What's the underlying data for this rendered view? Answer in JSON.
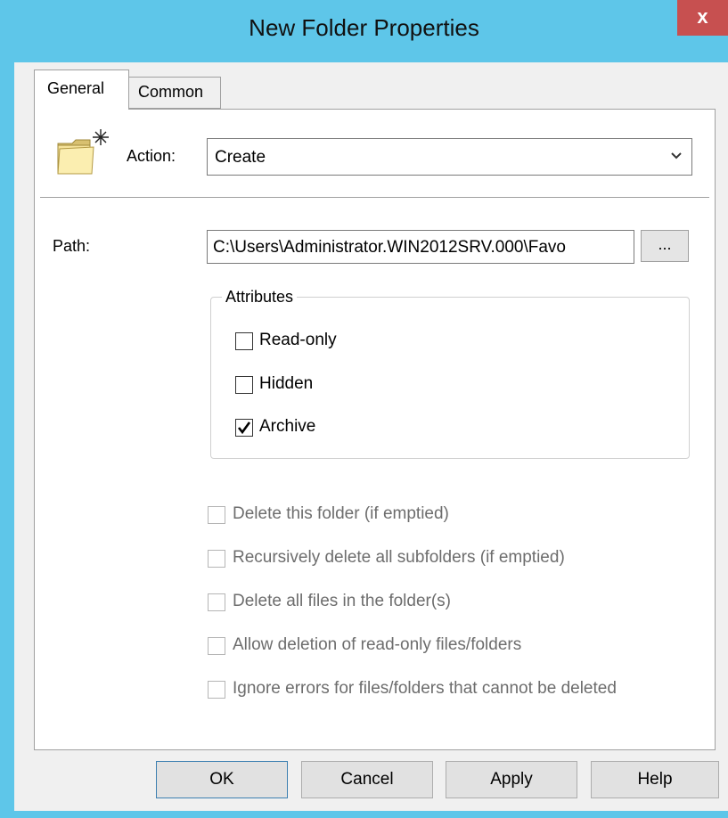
{
  "window": {
    "title": "New Folder Properties",
    "close_label": "x"
  },
  "tabs": [
    {
      "label": "General"
    },
    {
      "label": "Common"
    }
  ],
  "general": {
    "action_label": "Action:",
    "action_value": "Create",
    "path_label": "Path:",
    "path_value": "C:\\Users\\Administrator.WIN2012SRV.000\\Favo",
    "browse_label": "...",
    "attributes_title": "Attributes",
    "attributes": [
      {
        "label": "Read-only",
        "checked": false
      },
      {
        "label": "Hidden",
        "checked": false
      },
      {
        "label": "Archive",
        "checked": true
      }
    ],
    "delete_options": [
      {
        "label": "Delete this folder (if emptied)",
        "checked": false,
        "enabled": false
      },
      {
        "label": "Recursively delete all subfolders (if emptied)",
        "checked": false,
        "enabled": false
      },
      {
        "label": "Delete all files in the folder(s)",
        "checked": false,
        "enabled": false
      },
      {
        "label": "Allow deletion of read-only files/folders",
        "checked": false,
        "enabled": false
      },
      {
        "label": "Ignore errors for files/folders that cannot be deleted",
        "checked": false,
        "enabled": false
      }
    ]
  },
  "buttons": {
    "ok": "OK",
    "cancel": "Cancel",
    "apply": "Apply",
    "help": "Help"
  },
  "icons": {
    "close": "close-icon",
    "folder": "new-folder-icon",
    "dropdown": "chevron-down-icon",
    "check": "checkmark-icon"
  },
  "colors": {
    "title_bar": "#5ec6e9",
    "close_button": "#c75050",
    "default_button_border": "#3c7fb1"
  }
}
